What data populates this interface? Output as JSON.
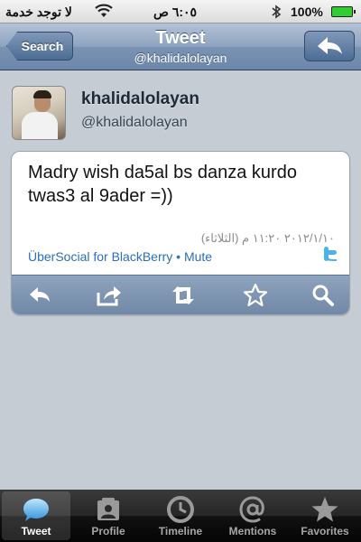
{
  "status_bar": {
    "carrier": "لا توجد خدمة",
    "time": "٦:٠٥ ص",
    "battery": "100%"
  },
  "nav": {
    "back_label": "Search",
    "title": "Tweet",
    "subtitle": "@khalidalolayan",
    "reply_icon": "reply-arrow-icon"
  },
  "profile": {
    "name": "khalidalolayan",
    "handle": "@khalidalolayan"
  },
  "tweet": {
    "text": "Madry wish da5al bs danza kurdo twas3 al 9ader =))",
    "date": "٢٠١٢/١/١٠ ١١:٢٠ م (الثلاثاء)",
    "source": "ÜberSocial for BlackBerry",
    "separator": " • ",
    "mute_label": "Mute"
  },
  "card_toolbar": {
    "icons": [
      "reply-icon",
      "share-icon",
      "retweet-icon",
      "star-icon",
      "search-icon"
    ]
  },
  "tabs": [
    {
      "label": "Tweet",
      "icon": "speech-bubble-icon",
      "active": true
    },
    {
      "label": "Profile",
      "icon": "profile-card-icon",
      "active": false
    },
    {
      "label": "Timeline",
      "icon": "clock-icon",
      "active": false
    },
    {
      "label": "Mentions",
      "icon": "at-icon",
      "active": false
    },
    {
      "label": "Favorites",
      "icon": "star-icon",
      "active": false
    }
  ],
  "colors": {
    "accent_link": "#2a6fb8",
    "nav_blue": "#6c87aa",
    "background": "#c5ccd4",
    "twitter_blue": "#4bb4e6"
  }
}
